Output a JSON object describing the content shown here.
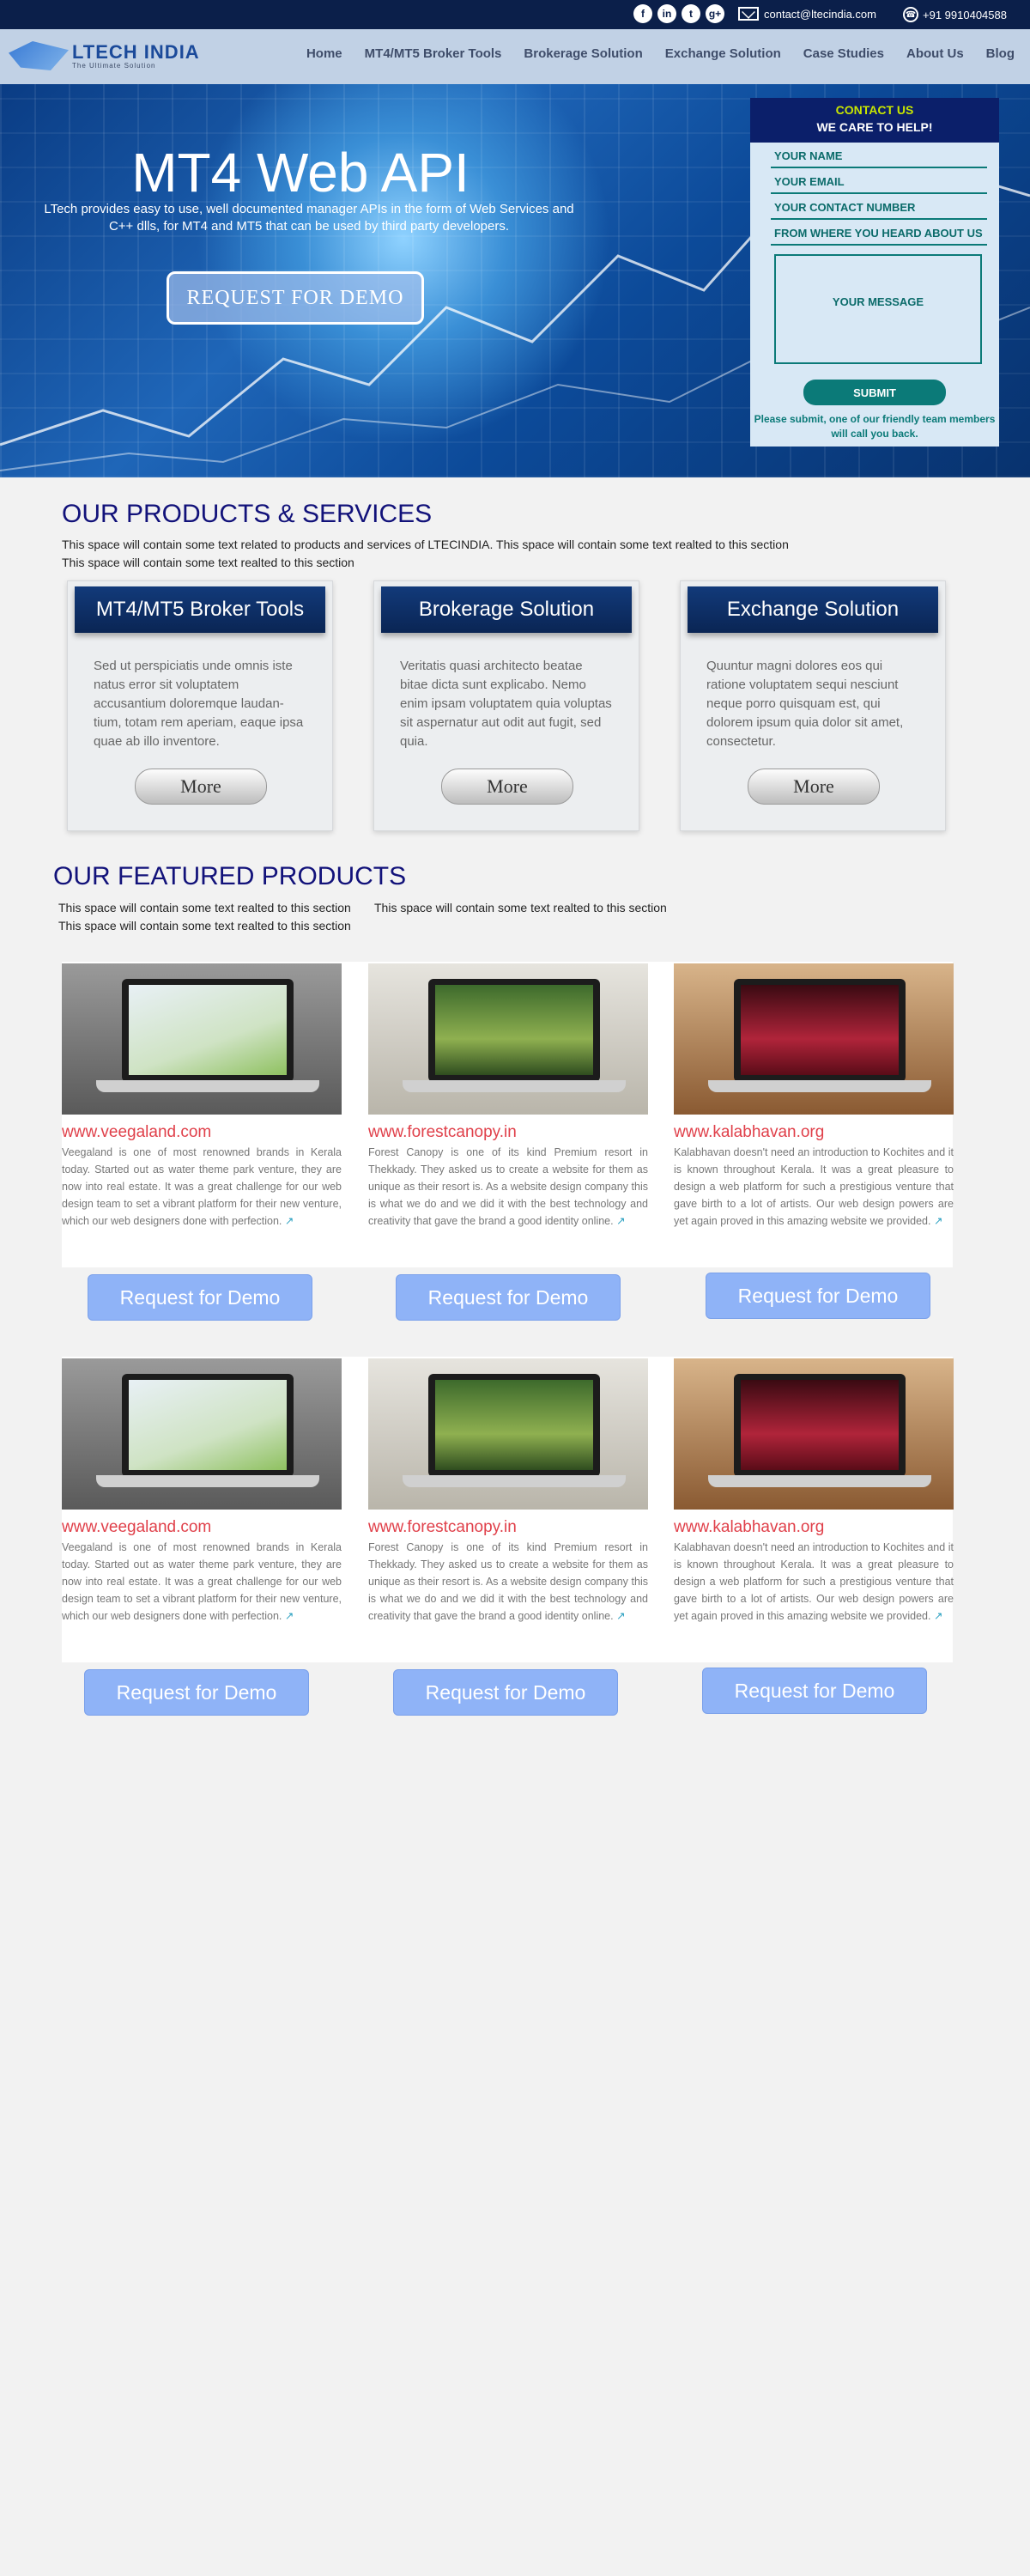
{
  "topbar": {
    "social": [
      "f",
      "in",
      "t",
      "g+"
    ],
    "email": "contact@ltecindia.com",
    "phone": "+91 9910404588"
  },
  "brand": {
    "name": "LTECH INDIA",
    "tagline": "The Ultimate Solution"
  },
  "nav": {
    "items": [
      "Home",
      "MT4/MT5 Broker Tools",
      "Brokerage Solution",
      "Exchange Solution",
      "Case Studies",
      "About Us",
      "Blog"
    ]
  },
  "hero": {
    "title": "MT4 Web API",
    "subtitle": "LTech provides easy to use, well documented manager APIs in the form of Web Services and C++ dlls, for MT4 and MT5 that can be used by third party developers.",
    "button": "REQUEST FOR DEMO"
  },
  "contact_form": {
    "head_a": "CONTACT US",
    "head_b": "WE CARE TO HELP!",
    "name": "YOUR NAME",
    "email": "YOUR EMAIL",
    "contact": "YOUR CONTACT NUMBER",
    "source": "FROM WHERE YOU HEARD ABOUT US",
    "message": "YOUR MESSAGE",
    "submit": "SUBMIT",
    "note": "Please submit, one of our friendly team members will call you back."
  },
  "products": {
    "title": "OUR PRODUCTS & SERVICES",
    "line1": "This space will contain some text related to products and services of LTECINDIA. This space will contain some text realted to this section",
    "line2": "This space will contain some text realted to this section",
    "cards": [
      {
        "title": "MT4/MT5 Broker Tools",
        "body": "Sed ut perspiciatis unde omnis iste natus error sit voluptatem accusantium doloremque laudan-tium, totam rem aperiam, eaque ipsa quae ab illo inventore.",
        "more": "More"
      },
      {
        "title": "Brokerage Solution",
        "body": "Veritatis quasi architecto beatae bitae dicta sunt explicabo. Nemo enim ipsam voluptatem quia voluptas sit aspernatur aut odit aut fugit, sed quia.",
        "more": "More"
      },
      {
        "title": "Exchange Solution",
        "body": "Quuntur magni dolores eos qui ratione voluptatem sequi nesciunt neque porro quisquam est, qui dolorem ipsum quia dolor sit amet, consectetur.",
        "more": "More"
      }
    ]
  },
  "featured": {
    "title": "OUR FEATURED PRODUCTS",
    "line1a": "This space will contain some text realted to this section",
    "line1b": "This space will contain some text realted to this section",
    "line2": "This space will contain some text realted to this section",
    "items": [
      {
        "url": "www.veegaland.com",
        "desc": "Veegaland is one of most renowned brands in Kerala today. Started out as water theme park venture, they are now into real estate. It was a great challenge for our web design team to set a vibrant platform for their new venture, which our web designers done with perfection.",
        "button": "Request for Demo"
      },
      {
        "url": "www.forestcanopy.in",
        "desc": "Forest Canopy is one of its kind Premium resort in Thekkady. They asked us to create a website for them as unique as their resort is. As a website design company this is what we do and we did it with the best technology and creativity that gave the brand a good identity online.",
        "button": "Request for Demo"
      },
      {
        "url": "www.kalabhavan.org",
        "desc": "Kalabhavan doesn't need an introduction to Kochites and it is known throughout Kerala. It was a great pleasure to design a web platform for such a prestigious venture that gave birth to a lot of artists. Our web design powers are yet again proved in this amazing website we provided.",
        "button": "Request for Demo"
      }
    ],
    "link_icon": "↗"
  }
}
